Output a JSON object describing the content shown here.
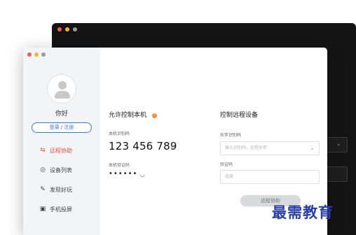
{
  "back_window": {
    "lights": [
      "red",
      "yellow",
      "grey"
    ],
    "field_chevron": "⌄"
  },
  "front_window": {
    "lights": [
      "red",
      "yellow",
      "grey"
    ]
  },
  "sidebar": {
    "greeting": "你好",
    "login_label": "登录 / 注册",
    "items": [
      {
        "label": "远程协助",
        "icon": "remote-assist-icon",
        "glyph": "⇆",
        "active": true
      },
      {
        "label": "设备列表",
        "icon": "device-list-icon",
        "glyph": "◎",
        "active": false
      },
      {
        "label": "发现好玩",
        "icon": "discover-icon",
        "glyph": "✎",
        "active": false
      },
      {
        "label": "手机投屏",
        "icon": "screen-cast-icon",
        "glyph": "▣",
        "active": false
      }
    ]
  },
  "allow_control": {
    "title": "允许控制本机",
    "info_glyph": "!",
    "device_id_label": "本机识别码",
    "device_id": "123 456 789",
    "copy_glyph": "⧉",
    "password_label": "本机验证码",
    "password": "••••••",
    "refresh_glyph": "◡"
  },
  "remote_control": {
    "title": "控制远程设备",
    "partner_label": "伙伴识别码",
    "partner_placeholder": "输入识别码、远程伙伴",
    "partner_chevron": "⌄",
    "verify_label": "验证码",
    "verify_placeholder": "选填",
    "connect_label": "远程协助"
  },
  "watermark": "最需教育",
  "colors": {
    "accent": "#3a74e0",
    "active_nav": "#e5533d",
    "info": "#f08a3c",
    "watermark": "#2a3ea8"
  }
}
